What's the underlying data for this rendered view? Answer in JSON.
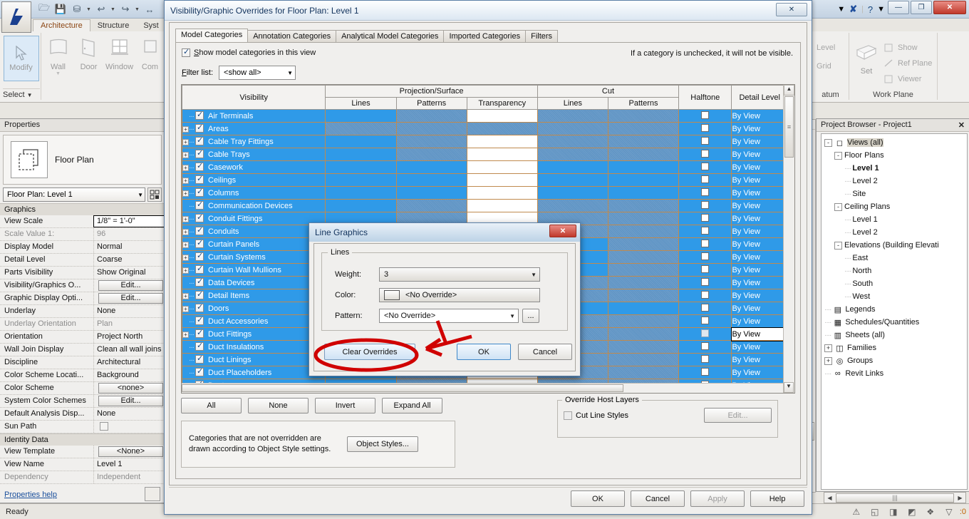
{
  "app": {
    "quick_access": [
      "open-icon",
      "save-icon",
      "sync-icon",
      "undo-icon",
      "redo-icon",
      "measure-icon"
    ],
    "ribbon_tabs": [
      {
        "label": "Architecture",
        "active": true
      },
      {
        "label": "Structure",
        "active": false
      },
      {
        "label": "Syst",
        "active": false
      }
    ],
    "panels": {
      "select": {
        "modify_label": "Modify",
        "select_label": "Select"
      },
      "build_buttons": [
        {
          "label": "Wall",
          "icon": "wall-icon"
        },
        {
          "label": "Door",
          "icon": "door-icon"
        },
        {
          "label": "Window",
          "icon": "window-icon"
        },
        {
          "label": "Com",
          "icon": "component-icon"
        }
      ],
      "datum": {
        "label": "atum",
        "items": [
          "Level",
          "Grid"
        ]
      },
      "workplane": {
        "label": "Work Plane",
        "set_label": "Set",
        "items": [
          "Show",
          "Ref  Plane",
          "Viewer"
        ]
      }
    },
    "window_buttons": {
      "minimize": "—",
      "restore": "❐",
      "close": "✕"
    },
    "help_icon": "help-icon",
    "x_icon": "x-icon"
  },
  "properties": {
    "title": "Properties",
    "type_name": "Floor Plan",
    "type_selector": "Floor Plan: Level 1",
    "groups": [
      {
        "name": "Graphics",
        "rows": [
          {
            "key": "View Scale",
            "value": "1/8\" = 1'-0\"",
            "style": "boxed"
          },
          {
            "key": "Scale Value   1:",
            "value": "96",
            "style": "dim"
          },
          {
            "key": "Display Model",
            "value": "Normal",
            "style": "text"
          },
          {
            "key": "Detail Level",
            "value": "Coarse",
            "style": "text"
          },
          {
            "key": "Parts Visibility",
            "value": "Show Original",
            "style": "text"
          },
          {
            "key": "Visibility/Graphics O...",
            "value": "Edit...",
            "style": "button"
          },
          {
            "key": "Graphic Display Opti...",
            "value": "Edit...",
            "style": "button"
          },
          {
            "key": "Underlay",
            "value": "None",
            "style": "text"
          },
          {
            "key": "Underlay Orientation",
            "value": "Plan",
            "style": "dim"
          },
          {
            "key": "Orientation",
            "value": "Project North",
            "style": "text"
          },
          {
            "key": "Wall Join Display",
            "value": "Clean all wall joins",
            "style": "text"
          },
          {
            "key": "Discipline",
            "value": "Architectural",
            "style": "text"
          },
          {
            "key": "Color Scheme Locati...",
            "value": "Background",
            "style": "text"
          },
          {
            "key": "Color Scheme",
            "value": "<none>",
            "style": "button"
          },
          {
            "key": "System Color Schemes",
            "value": "Edit...",
            "style": "button"
          },
          {
            "key": "Default Analysis Disp...",
            "value": "None",
            "style": "text"
          },
          {
            "key": "Sun Path",
            "value": "",
            "style": "checkbox"
          }
        ]
      },
      {
        "name": "Identity Data",
        "rows": [
          {
            "key": "View Template",
            "value": "<None>",
            "style": "button"
          },
          {
            "key": "View Name",
            "value": "Level 1",
            "style": "text"
          },
          {
            "key": "Dependency",
            "value": "Independent",
            "style": "dim"
          }
        ]
      }
    ],
    "help_link": "Properties help"
  },
  "browser": {
    "title": "Project Browser - Project1",
    "close_icon": "close-icon",
    "nodes": [
      {
        "label": "Views (all)",
        "depth": 0,
        "expander": "-",
        "icon": "views-icon",
        "selected": true,
        "bold": false
      },
      {
        "label": "Floor Plans",
        "depth": 1,
        "expander": "-",
        "icon": "",
        "selected": false,
        "bold": false
      },
      {
        "label": "Level 1",
        "depth": 2,
        "expander": "",
        "icon": "",
        "selected": false,
        "bold": true
      },
      {
        "label": "Level 2",
        "depth": 2,
        "expander": "",
        "icon": "",
        "selected": false,
        "bold": false
      },
      {
        "label": "Site",
        "depth": 2,
        "expander": "",
        "icon": "",
        "selected": false,
        "bold": false
      },
      {
        "label": "Ceiling Plans",
        "depth": 1,
        "expander": "-",
        "icon": "",
        "selected": false,
        "bold": false
      },
      {
        "label": "Level 1",
        "depth": 2,
        "expander": "",
        "icon": "",
        "selected": false,
        "bold": false
      },
      {
        "label": "Level 2",
        "depth": 2,
        "expander": "",
        "icon": "",
        "selected": false,
        "bold": false
      },
      {
        "label": "Elevations (Building Elevati",
        "depth": 1,
        "expander": "-",
        "icon": "",
        "selected": false,
        "bold": false
      },
      {
        "label": "East",
        "depth": 2,
        "expander": "",
        "icon": "",
        "selected": false,
        "bold": false
      },
      {
        "label": "North",
        "depth": 2,
        "expander": "",
        "icon": "",
        "selected": false,
        "bold": false
      },
      {
        "label": "South",
        "depth": 2,
        "expander": "",
        "icon": "",
        "selected": false,
        "bold": false
      },
      {
        "label": "West",
        "depth": 2,
        "expander": "",
        "icon": "",
        "selected": false,
        "bold": false
      },
      {
        "label": "Legends",
        "depth": 0,
        "expander": "",
        "icon": "legend-icon",
        "selected": false,
        "bold": false
      },
      {
        "label": "Schedules/Quantities",
        "depth": 0,
        "expander": "",
        "icon": "schedule-icon",
        "selected": false,
        "bold": false
      },
      {
        "label": "Sheets (all)",
        "depth": 0,
        "expander": "",
        "icon": "sheet-icon",
        "selected": false,
        "bold": false
      },
      {
        "label": "Families",
        "depth": 0,
        "expander": "+",
        "icon": "family-icon",
        "selected": false,
        "bold": false
      },
      {
        "label": "Groups",
        "depth": 0,
        "expander": "+",
        "icon": "group-icon",
        "selected": false,
        "bold": false
      },
      {
        "label": "Revit Links",
        "depth": 0,
        "expander": "",
        "icon": "link-icon",
        "selected": false,
        "bold": false
      }
    ]
  },
  "vg_dialog": {
    "title": "Visibility/Graphic Overrides for Floor Plan: Level 1",
    "close_icon": "close-icon",
    "tabs": [
      {
        "label": "Model Categories",
        "active": true
      },
      {
        "label": "Annotation Categories",
        "active": false
      },
      {
        "label": "Analytical Model Categories",
        "active": false
      },
      {
        "label": "Imported Categories",
        "active": false
      },
      {
        "label": "Filters",
        "active": false
      }
    ],
    "show_categories_label": "Show model categories in this view",
    "show_categories_checked": true,
    "hint": "If a category is unchecked, it will not be visible.",
    "filter_list_label": "Filter list:",
    "filter_list_value": "<show all>",
    "headers": {
      "visibility": "Visibility",
      "projection_surface": "Projection/Surface",
      "cut": "Cut",
      "halftone": "Halftone",
      "detail_level": "Detail Level",
      "sub": {
        "lines": "Lines",
        "patterns": "Patterns",
        "transparency": "Transparency",
        "cut_lines": "Lines",
        "cut_patterns": "Patterns"
      }
    },
    "rows": [
      {
        "name": "Air Terminals",
        "expandable": false,
        "checked": true,
        "detail": "By View",
        "cells": [
          "blue",
          "dis",
          "white",
          "dis",
          "dis"
        ],
        "selected": false
      },
      {
        "name": "Areas",
        "expandable": true,
        "checked": true,
        "detail": "By View",
        "cells": [
          "dis",
          "dis",
          "dis",
          "dis",
          "dis"
        ],
        "selected": false
      },
      {
        "name": "Cable Tray Fittings",
        "expandable": true,
        "checked": true,
        "detail": "By View",
        "cells": [
          "blue",
          "dis",
          "white",
          "dis",
          "dis"
        ],
        "selected": false
      },
      {
        "name": "Cable Trays",
        "expandable": true,
        "checked": true,
        "detail": "By View",
        "cells": [
          "blue",
          "dis",
          "white",
          "dis",
          "dis"
        ],
        "selected": false
      },
      {
        "name": "Casework",
        "expandable": true,
        "checked": true,
        "detail": "By View",
        "cells": [
          "blue",
          "blue",
          "white",
          "blue",
          "blue"
        ],
        "selected": false
      },
      {
        "name": "Ceilings",
        "expandable": true,
        "checked": true,
        "detail": "By View",
        "cells": [
          "blue",
          "blue",
          "white",
          "blue",
          "blue"
        ],
        "selected": false
      },
      {
        "name": "Columns",
        "expandable": true,
        "checked": true,
        "detail": "By View",
        "cells": [
          "blue",
          "blue",
          "white",
          "blue",
          "blue"
        ],
        "selected": false
      },
      {
        "name": "Communication Devices",
        "expandable": false,
        "checked": true,
        "detail": "By View",
        "cells": [
          "blue",
          "dis",
          "white",
          "dis",
          "dis"
        ],
        "selected": false
      },
      {
        "name": "Conduit Fittings",
        "expandable": true,
        "checked": true,
        "detail": "By View",
        "cells": [
          "blue",
          "dis",
          "white",
          "dis",
          "dis"
        ],
        "selected": false
      },
      {
        "name": "Conduits",
        "expandable": true,
        "checked": true,
        "detail": "By View",
        "cells": [
          "blue",
          "dis",
          "white",
          "dis",
          "dis"
        ],
        "selected": false
      },
      {
        "name": "Curtain Panels",
        "expandable": true,
        "checked": true,
        "detail": "By View",
        "cells": [
          "blue",
          "blue",
          "white",
          "blue",
          "dis"
        ],
        "selected": false
      },
      {
        "name": "Curtain Systems",
        "expandable": true,
        "checked": true,
        "detail": "By View",
        "cells": [
          "blue",
          "blue",
          "white",
          "blue",
          "dis"
        ],
        "selected": false
      },
      {
        "name": "Curtain Wall Mullions",
        "expandable": true,
        "checked": true,
        "detail": "By View",
        "cells": [
          "blue",
          "blue",
          "white",
          "blue",
          "dis"
        ],
        "selected": false
      },
      {
        "name": "Data Devices",
        "expandable": false,
        "checked": true,
        "detail": "By View",
        "cells": [
          "blue",
          "dis",
          "white",
          "dis",
          "dis"
        ],
        "selected": false
      },
      {
        "name": "Detail Items",
        "expandable": true,
        "checked": true,
        "detail": "By View",
        "cells": [
          "blue",
          "blue",
          "white",
          "dis",
          "dis"
        ],
        "selected": false
      },
      {
        "name": "Doors",
        "expandable": true,
        "checked": true,
        "detail": "By View",
        "cells": [
          "blue",
          "blue",
          "white",
          "blue",
          "blue"
        ],
        "selected": false
      },
      {
        "name": "Duct Accessories",
        "expandable": false,
        "checked": true,
        "detail": "By View",
        "cells": [
          "blue",
          "dis",
          "white",
          "dis",
          "dis"
        ],
        "selected": false
      },
      {
        "name": "Duct Fittings",
        "expandable": true,
        "checked": true,
        "detail": "By View",
        "cells": [
          "blue",
          "dis",
          "white",
          "dis",
          "dis"
        ],
        "selected": true
      },
      {
        "name": "Duct Insulations",
        "expandable": false,
        "checked": true,
        "detail": "By View",
        "cells": [
          "blue",
          "dis",
          "white",
          "dis",
          "dis"
        ],
        "selected": false
      },
      {
        "name": "Duct Linings",
        "expandable": false,
        "checked": true,
        "detail": "By View",
        "cells": [
          "blue",
          "dis",
          "white",
          "dis",
          "dis"
        ],
        "selected": false
      },
      {
        "name": "Duct Placeholders",
        "expandable": false,
        "checked": true,
        "detail": "By View",
        "cells": [
          "blue",
          "dis",
          "white",
          "dis",
          "dis"
        ],
        "selected": false
      },
      {
        "name": "Ducts",
        "expandable": true,
        "checked": true,
        "detail": "By View",
        "cells": [
          "blue",
          "dis",
          "white",
          "dis",
          "dis"
        ],
        "selected": false
      }
    ],
    "action_buttons": [
      "All",
      "None",
      "Invert",
      "Expand All"
    ],
    "info_text": "Categories that are not overridden are drawn according to Object Style settings.",
    "object_styles_button": "Object Styles...",
    "override_host_layers": {
      "caption": "Override Host Layers",
      "cut_line_styles_label": "Cut Line Styles",
      "cut_line_styles_checked": false,
      "edit_button": "Edit..."
    },
    "footer_buttons": [
      {
        "label": "OK",
        "enabled": true
      },
      {
        "label": "Cancel",
        "enabled": true
      },
      {
        "label": "Apply",
        "enabled": false
      },
      {
        "label": "Help",
        "enabled": true
      }
    ]
  },
  "line_graphics_dialog": {
    "title": "Line Graphics",
    "close_icon": "close-icon",
    "group_caption": "Lines",
    "fields": [
      {
        "label": "Weight:",
        "value": "3",
        "type": "dropdown"
      },
      {
        "label": "Color:",
        "value": "<No Override>",
        "type": "color"
      },
      {
        "label": "Pattern:",
        "value": "<No Override>",
        "type": "dropdown-with-browse"
      }
    ],
    "browse_button": "...",
    "clear_overrides_button": "Clear Overrides",
    "ok_button": "OK",
    "cancel_button": "Cancel"
  },
  "statusbar": {
    "message": "Ready",
    "filter_count": ":0",
    "icons": [
      "warning-icon",
      "select-underlay-icon",
      "select-pinned-icon",
      "select-link-icon",
      "select-face-icon",
      "filter-icon"
    ]
  },
  "colors": {
    "selection_blue": "#2f9ae8",
    "disabled_cell": "#5d93c4",
    "grid_line": "#c08a4e",
    "annotation_red": "#d00000",
    "accent_brown": "#8b4513"
  }
}
